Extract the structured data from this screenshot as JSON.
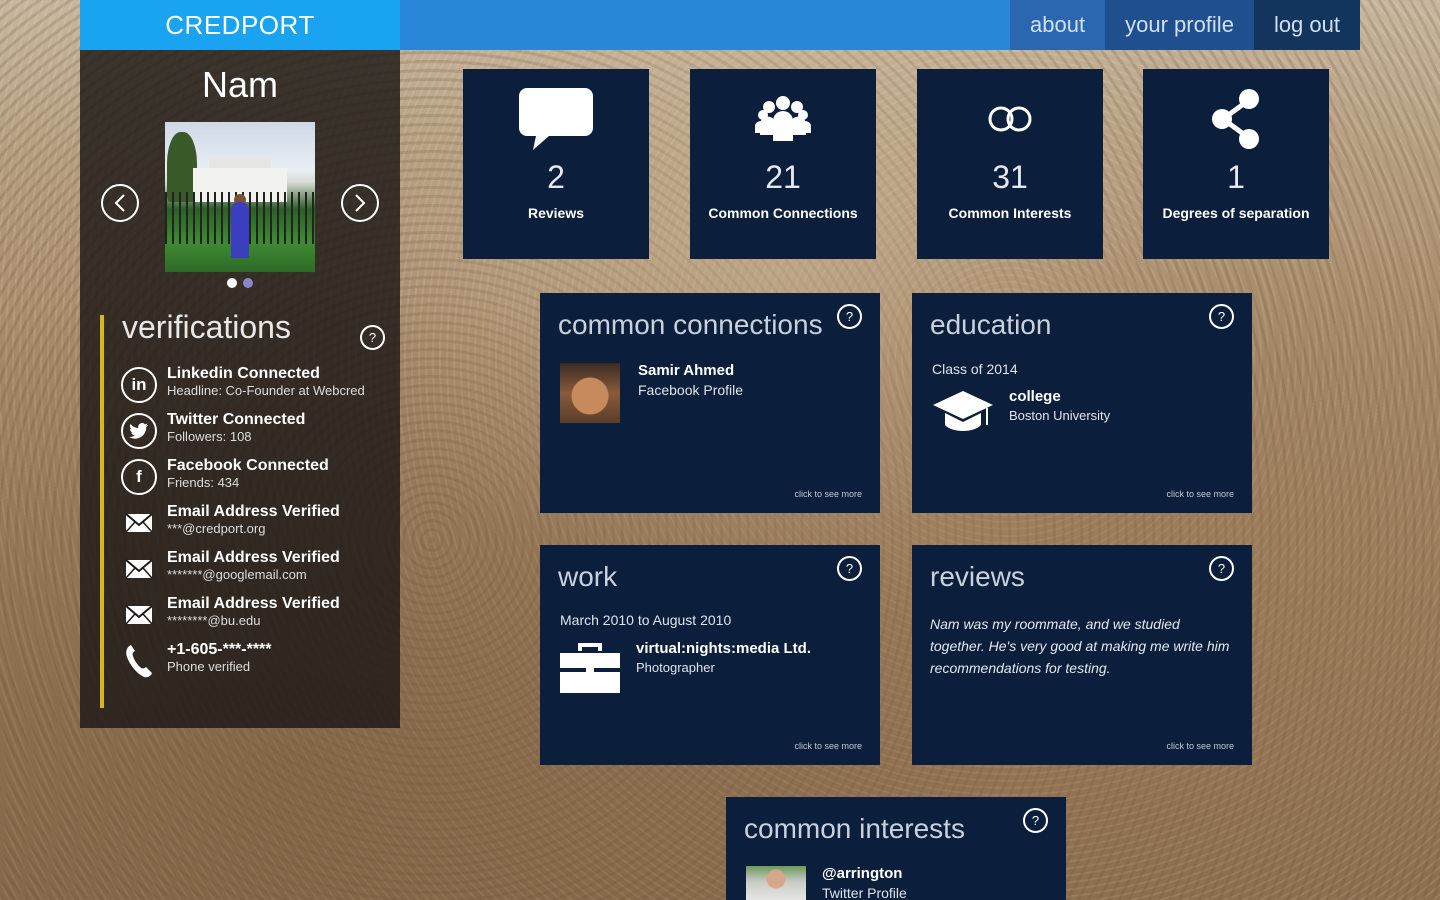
{
  "topbar": {
    "brand": "CREDPORT",
    "nav": [
      {
        "label": "about"
      },
      {
        "label": "your profile"
      },
      {
        "label": "log out"
      }
    ]
  },
  "profile": {
    "name": "Nam",
    "photo_alt": "profile photo",
    "photo_count": 2,
    "photo_index": 1
  },
  "verifications": {
    "title": "verifications",
    "help": "?",
    "items": [
      {
        "icon": "linkedin-icon",
        "title": "Linkedin Connected",
        "sub": "Headline: Co-Founder at Webcred"
      },
      {
        "icon": "twitter-icon",
        "title": "Twitter Connected",
        "sub": "Followers: 108"
      },
      {
        "icon": "facebook-icon",
        "title": "Facebook Connected",
        "sub": "Friends: 434"
      },
      {
        "icon": "envelope-icon",
        "title": "Email Address Verified",
        "sub": "***@credport.org"
      },
      {
        "icon": "envelope-icon",
        "title": "Email Address Verified",
        "sub": "*******@googlemail.com"
      },
      {
        "icon": "envelope-icon",
        "title": "Email Address Verified",
        "sub": "********@bu.edu"
      },
      {
        "icon": "phone-icon",
        "title": "+1-605-***-****",
        "sub": "Phone verified"
      }
    ]
  },
  "stats": [
    {
      "icon": "speech-bubble-icon",
      "value": "2",
      "label": "Reviews"
    },
    {
      "icon": "group-icon",
      "value": "21",
      "label": "Common Connections"
    },
    {
      "icon": "rings-icon",
      "value": "31",
      "label": "Common Interests"
    },
    {
      "icon": "share-icon",
      "value": "1",
      "label": "Degrees of separation"
    }
  ],
  "cards": {
    "connections": {
      "title": "common connections",
      "help": "?",
      "name": "Samir Ahmed",
      "source": "Facebook Profile",
      "more": "click to see more"
    },
    "education": {
      "title": "education",
      "help": "?",
      "class": "Class of 2014",
      "level": "college",
      "school": "Boston University",
      "more": "click to see more"
    },
    "work": {
      "title": "work",
      "help": "?",
      "period": "March 2010 to August 2010",
      "company": "virtual:nights:media Ltd.",
      "role": "Photographer",
      "more": "click to see more"
    },
    "reviews": {
      "title": "reviews",
      "help": "?",
      "text": "Nam was my roommate, and we studied together. He's very good at making me write him recommendations for testing.",
      "more": "click to see more"
    },
    "interests": {
      "title": "common interests",
      "help": "?",
      "name": "@arrington",
      "source": "Twitter Profile"
    }
  },
  "colors": {
    "brand_bg": "#1aa3f0",
    "topbar_bg": "#2a86d8",
    "card_bg": "#0b1f3c",
    "verification_accent": "#d9b51e"
  }
}
